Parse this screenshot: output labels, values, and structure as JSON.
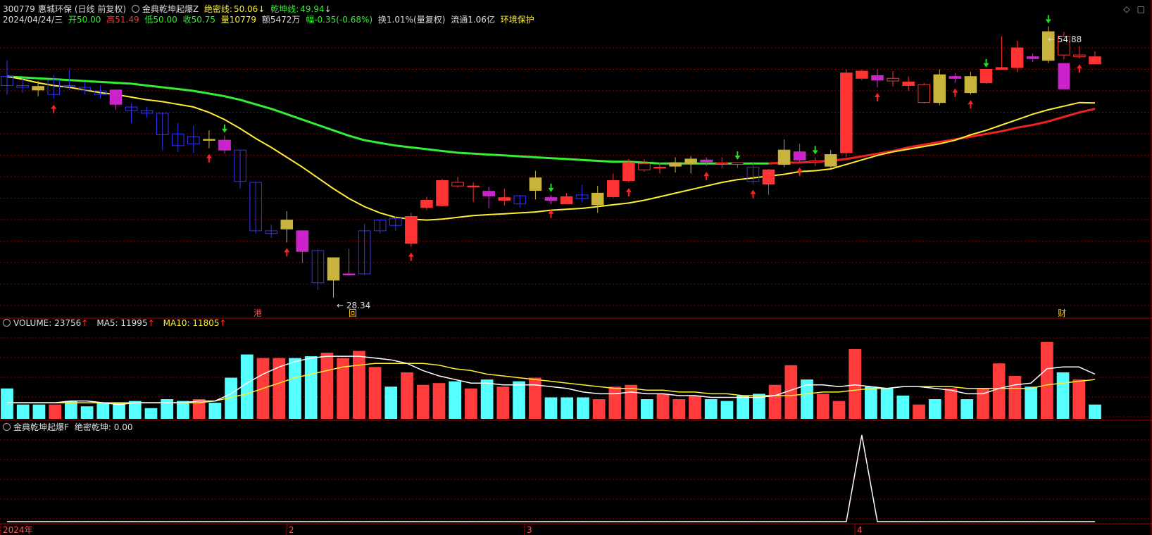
{
  "header": {
    "code": "300779",
    "name": "惠城环保",
    "mode": "(日线 前复权)",
    "indicator_name": "金典乾坤起爆Z",
    "line1_label": "绝密线:",
    "line1_value": "50.06",
    "line2_label": "乾坤线:",
    "line2_value": "49.94"
  },
  "quote": {
    "date": "2024/04/24/三",
    "open": "开50.00",
    "high": "高51.49",
    "low": "低50.00",
    "close": "收50.75",
    "volume": "量10779",
    "amount": "额5472万",
    "change": "幅-0.35(-0.68%)",
    "turnover": "换1.01%(量复权)",
    "float": "流通1.06亿",
    "sector": "环境保护"
  },
  "price_annotations": {
    "high_label": "54.88",
    "low_label": "28.34",
    "marker_gang": "港",
    "marker_hui": "回",
    "marker_cai": "财"
  },
  "volume_panel": {
    "label": "VOLUME: 23756",
    "ma5": "MA5: 11995",
    "ma10": "MA10: 11805"
  },
  "indicator_panel": {
    "name": "金典乾坤起爆F",
    "value_label": "绝密乾坤: 0.00"
  },
  "x_axis": {
    "labels": [
      "2024年",
      "2",
      "3",
      "4"
    ]
  },
  "icons": {
    "top_right": [
      "diamond-icon",
      "square-icon"
    ]
  },
  "colors": {
    "up": "#ff3333",
    "down_blue": "#3333ff",
    "vol_up": "#ff3b3b",
    "vol_down": "#55ffff",
    "ma_yellow": "#ffee33",
    "ma_green": "#33ee33",
    "ma_red": "#ee2222",
    "grid": "#8b0000"
  },
  "chart_data": {
    "type": "candlestick",
    "price_range": [
      27,
      58
    ],
    "candles": [
      [
        53.0,
        54.8,
        51.0,
        52.0,
        "b"
      ],
      [
        52.0,
        52.8,
        51.2,
        51.8,
        "b"
      ],
      [
        51.9,
        52.5,
        50.8,
        51.5,
        "g"
      ],
      [
        51.0,
        53.2,
        50.5,
        52.6,
        "b"
      ],
      [
        52.0,
        53.8,
        51.5,
        52.0,
        "b"
      ],
      [
        51.8,
        52.4,
        51.0,
        51.5,
        "b"
      ],
      [
        51.4,
        52.0,
        50.5,
        51.0,
        "b"
      ],
      [
        51.5,
        51.5,
        49.3,
        49.9,
        "m"
      ],
      [
        49.6,
        50.0,
        47.8,
        49.2,
        "b"
      ],
      [
        49.2,
        49.6,
        48.4,
        48.9,
        "b"
      ],
      [
        48.9,
        49.0,
        44.8,
        46.5,
        "b"
      ],
      [
        46.6,
        47.8,
        44.6,
        45.3,
        "b"
      ],
      [
        45.5,
        47.5,
        44.5,
        46.3,
        "b"
      ],
      [
        46.0,
        47.0,
        45.0,
        46.0,
        "g"
      ],
      [
        45.9,
        46.4,
        44.4,
        44.8,
        "m"
      ],
      [
        44.8,
        44.8,
        40.5,
        41.3,
        "b"
      ],
      [
        41.2,
        41.2,
        35.5,
        35.8,
        "b"
      ],
      [
        35.5,
        36.5,
        35.0,
        35.8,
        "b"
      ],
      [
        36.0,
        38.0,
        34.5,
        37.0,
        "g"
      ],
      [
        35.8,
        35.8,
        32.2,
        33.5,
        "m"
      ],
      [
        33.6,
        33.8,
        29.2,
        30.0,
        "b"
      ],
      [
        32.8,
        32.8,
        28.34,
        30.3,
        "g"
      ],
      [
        31.0,
        33.8,
        30.8,
        31.0,
        "m"
      ],
      [
        31.0,
        36.6,
        30.9,
        35.8,
        "b"
      ],
      [
        35.8,
        37.0,
        35.5,
        37.0,
        "b"
      ],
      [
        36.4,
        37.4,
        35.8,
        37.2,
        "b"
      ],
      [
        34.4,
        37.8,
        34.0,
        37.4,
        "r"
      ],
      [
        38.4,
        39.6,
        38.1,
        39.2,
        "r"
      ],
      [
        38.6,
        41.6,
        38.5,
        41.4,
        "r"
      ],
      [
        40.8,
        41.8,
        40.6,
        41.2,
        "rh"
      ],
      [
        40.8,
        41.2,
        39.0,
        40.8,
        "r"
      ],
      [
        39.7,
        40.7,
        38.3,
        40.2,
        "m"
      ],
      [
        39.2,
        40.5,
        38.6,
        39.5,
        "r"
      ],
      [
        38.8,
        39.8,
        38.4,
        39.7,
        "b"
      ],
      [
        40.3,
        42.5,
        39.3,
        41.7,
        "g"
      ],
      [
        39.2,
        39.8,
        38.8,
        39.5,
        "m"
      ],
      [
        38.8,
        40.0,
        38.8,
        39.6,
        "r"
      ],
      [
        39.4,
        40.9,
        39.0,
        39.8,
        "b"
      ],
      [
        38.7,
        40.8,
        37.8,
        40.0,
        "g"
      ],
      [
        39.6,
        42.2,
        39.5,
        41.4,
        "r"
      ],
      [
        41.4,
        43.8,
        41.2,
        43.4,
        "r"
      ],
      [
        42.6,
        43.8,
        42.4,
        43.3,
        "rh"
      ],
      [
        42.8,
        43.4,
        42.2,
        42.9,
        "r"
      ],
      [
        43.0,
        44.0,
        42.3,
        43.4,
        "g"
      ],
      [
        43.3,
        44.1,
        42.2,
        43.8,
        "g"
      ],
      [
        43.5,
        44.0,
        43.0,
        43.7,
        "m"
      ],
      [
        43.4,
        44.0,
        42.8,
        43.4,
        "rh"
      ],
      [
        43.2,
        43.4,
        42.8,
        43.4,
        "rh"
      ],
      [
        42.9,
        43.5,
        41.0,
        41.3,
        "b"
      ],
      [
        41.0,
        42.7,
        39.8,
        42.6,
        "r"
      ],
      [
        43.2,
        46.0,
        42.9,
        44.8,
        "g"
      ],
      [
        43.7,
        45.5,
        43.5,
        44.6,
        "m"
      ],
      [
        43.6,
        44.0,
        43.0,
        43.5,
        "rh"
      ],
      [
        43.0,
        44.8,
        42.8,
        44.3,
        "g"
      ],
      [
        44.5,
        53.8,
        44.0,
        53.4,
        "r"
      ],
      [
        52.8,
        53.8,
        52.6,
        53.6,
        "r"
      ],
      [
        53.1,
        53.8,
        51.8,
        52.6,
        "m"
      ],
      [
        52.8,
        53.6,
        51.9,
        52.5,
        "rh"
      ],
      [
        52.0,
        53.0,
        51.4,
        52.4,
        "r"
      ],
      [
        50.1,
        52.3,
        50.0,
        52.1,
        "rh"
      ],
      [
        50.1,
        53.8,
        49.8,
        53.2,
        "g"
      ],
      [
        52.8,
        53.4,
        52.3,
        53.0,
        "m"
      ],
      [
        51.2,
        53.5,
        51.0,
        53.0,
        "g"
      ],
      [
        52.3,
        53.7,
        52.2,
        53.8,
        "r"
      ],
      [
        53.8,
        57.5,
        53.8,
        54.0,
        "r"
      ],
      [
        54.0,
        57.0,
        53.5,
        56.2,
        "r"
      ],
      [
        55.0,
        55.6,
        54.6,
        55.2,
        "m"
      ],
      [
        54.8,
        58.6,
        54.5,
        58.0,
        "g"
      ],
      [
        57.5,
        58.0,
        54.9,
        55.4,
        "mh"
      ],
      [
        55.2,
        56.4,
        55.0,
        55.4,
        "rh"
      ],
      [
        54.4,
        55.8,
        54.4,
        55.2,
        "r"
      ]
    ],
    "ma_yellow": [
      53.0,
      52.7,
      52.3,
      52.0,
      51.8,
      51.5,
      51.2,
      51.0,
      50.7,
      50.4,
      50.2,
      49.9,
      49.6,
      49.0,
      48.2,
      47.2,
      46.1,
      45.1,
      44.0,
      42.9,
      41.7,
      40.5,
      39.4,
      38.5,
      37.8,
      37.3,
      37.1,
      37.0,
      37.1,
      37.3,
      37.5,
      37.6,
      37.7,
      37.8,
      37.9,
      38.1,
      38.2,
      38.3,
      38.5,
      38.7,
      38.9,
      39.2,
      39.6,
      40.0,
      40.4,
      40.8,
      41.2,
      41.5,
      41.7,
      41.9,
      42.1,
      42.4,
      42.5,
      42.7,
      43.2,
      43.7,
      44.2,
      44.6,
      44.9,
      45.2,
      45.5,
      45.9,
      46.5,
      47.0,
      47.6,
      48.2,
      48.8,
      49.3,
      49.7,
      50.1,
      50.06
    ],
    "ma_green": [
      53.0,
      52.9,
      52.8,
      52.7,
      52.6,
      52.5,
      52.4,
      52.3,
      52.2,
      52.0,
      51.8,
      51.6,
      51.4,
      51.1,
      50.8,
      50.4,
      49.9,
      49.4,
      48.8,
      48.2,
      47.6,
      47.0,
      46.4,
      45.9,
      45.6,
      45.3,
      45.1,
      44.9,
      44.7,
      44.5,
      44.4,
      44.3,
      44.2,
      44.1,
      44.0,
      43.9,
      43.8,
      43.7,
      43.6,
      43.5,
      43.5,
      43.4,
      43.3,
      43.3,
      43.3,
      43.3,
      43.3,
      43.3,
      43.3,
      43.3
    ],
    "ma_red_start_index": 49,
    "ma_red": [
      43.3,
      43.4,
      43.4,
      43.5,
      43.6,
      43.8,
      44.1,
      44.4,
      44.7,
      45.1,
      45.4,
      45.7,
      46.0,
      46.3,
      46.6,
      46.9,
      47.3,
      47.6,
      48.0,
      48.5,
      49.0,
      49.4
    ],
    "arrows_up": [
      3,
      13,
      18,
      26,
      35,
      40,
      45,
      48,
      51,
      56,
      61,
      62,
      69
    ],
    "arrows_down": [
      14,
      35,
      47,
      52,
      63,
      67
    ],
    "volume": [
      [
        17,
        "c"
      ],
      [
        8,
        "c"
      ],
      [
        8,
        "c"
      ],
      [
        8,
        "r"
      ],
      [
        10,
        "c"
      ],
      [
        7,
        "c"
      ],
      [
        9,
        "c"
      ],
      [
        9,
        "c"
      ],
      [
        10,
        "c"
      ],
      [
        6,
        "c"
      ],
      [
        11,
        "c"
      ],
      [
        10,
        "c"
      ],
      [
        11,
        "r"
      ],
      [
        9,
        "c"
      ],
      [
        23,
        "c"
      ],
      [
        36,
        "c"
      ],
      [
        34,
        "r"
      ],
      [
        34,
        "r"
      ],
      [
        34,
        "c"
      ],
      [
        35,
        "c"
      ],
      [
        37,
        "r"
      ],
      [
        34,
        "r"
      ],
      [
        38,
        "r"
      ],
      [
        29,
        "r"
      ],
      [
        18,
        "c"
      ],
      [
        26,
        "r"
      ],
      [
        19,
        "r"
      ],
      [
        20,
        "r"
      ],
      [
        21,
        "c"
      ],
      [
        17,
        "r"
      ],
      [
        22,
        "c"
      ],
      [
        18,
        "r"
      ],
      [
        21,
        "c"
      ],
      [
        23,
        "r"
      ],
      [
        12,
        "c"
      ],
      [
        12,
        "c"
      ],
      [
        12,
        "c"
      ],
      [
        11,
        "r"
      ],
      [
        18,
        "r"
      ],
      [
        19,
        "r"
      ],
      [
        11,
        "c"
      ],
      [
        14,
        "r"
      ],
      [
        11,
        "r"
      ],
      [
        13,
        "r"
      ],
      [
        11,
        "c"
      ],
      [
        10,
        "c"
      ],
      [
        13,
        "c"
      ],
      [
        14,
        "c"
      ],
      [
        19,
        "r"
      ],
      [
        30,
        "r"
      ],
      [
        22,
        "c"
      ],
      [
        14,
        "r"
      ],
      [
        10,
        "r"
      ],
      [
        39,
        "r"
      ],
      [
        18,
        "c"
      ],
      [
        17,
        "c"
      ],
      [
        13,
        "c"
      ],
      [
        8,
        "r"
      ],
      [
        11,
        "c"
      ],
      [
        17,
        "r"
      ],
      [
        11,
        "c"
      ],
      [
        17,
        "r"
      ],
      [
        31,
        "r"
      ],
      [
        24,
        "r"
      ],
      [
        18,
        "c"
      ],
      [
        43,
        "r"
      ],
      [
        26,
        "c"
      ],
      [
        22,
        "r"
      ],
      [
        8,
        "c"
      ]
    ],
    "vol_ma5": [
      9,
      9,
      9,
      9,
      10,
      10,
      9,
      8,
      9,
      9,
      9,
      9,
      10,
      10,
      14,
      20,
      25,
      29,
      32,
      34,
      35,
      35,
      35,
      34,
      33,
      31,
      27,
      24,
      22,
      20,
      20,
      19,
      19,
      19,
      18,
      17,
      15,
      14,
      14,
      15,
      14,
      14,
      13,
      13,
      12,
      12,
      12,
      12,
      13,
      16,
      19,
      19,
      18,
      19,
      18,
      17,
      18,
      18,
      17,
      16,
      14,
      14,
      17,
      19,
      20,
      28,
      29,
      29,
      25
    ],
    "vol_ma10": [
      9,
      9,
      9,
      9,
      9,
      9,
      9,
      9,
      9,
      9,
      9,
      9,
      9,
      10,
      12,
      14,
      17,
      20,
      23,
      25,
      27,
      29,
      30,
      31,
      31,
      31,
      31,
      30,
      28,
      27,
      25,
      24,
      23,
      22,
      21,
      20,
      19,
      18,
      17,
      17,
      16,
      16,
      15,
      15,
      14,
      14,
      13,
      13,
      13,
      13,
      14,
      15,
      15,
      16,
      17,
      17,
      18,
      18,
      18,
      18,
      17,
      17,
      17,
      17,
      17,
      19,
      20,
      21,
      22
    ],
    "indicator": {
      "peak_index": 55,
      "values_note": "0 except spike"
    }
  }
}
